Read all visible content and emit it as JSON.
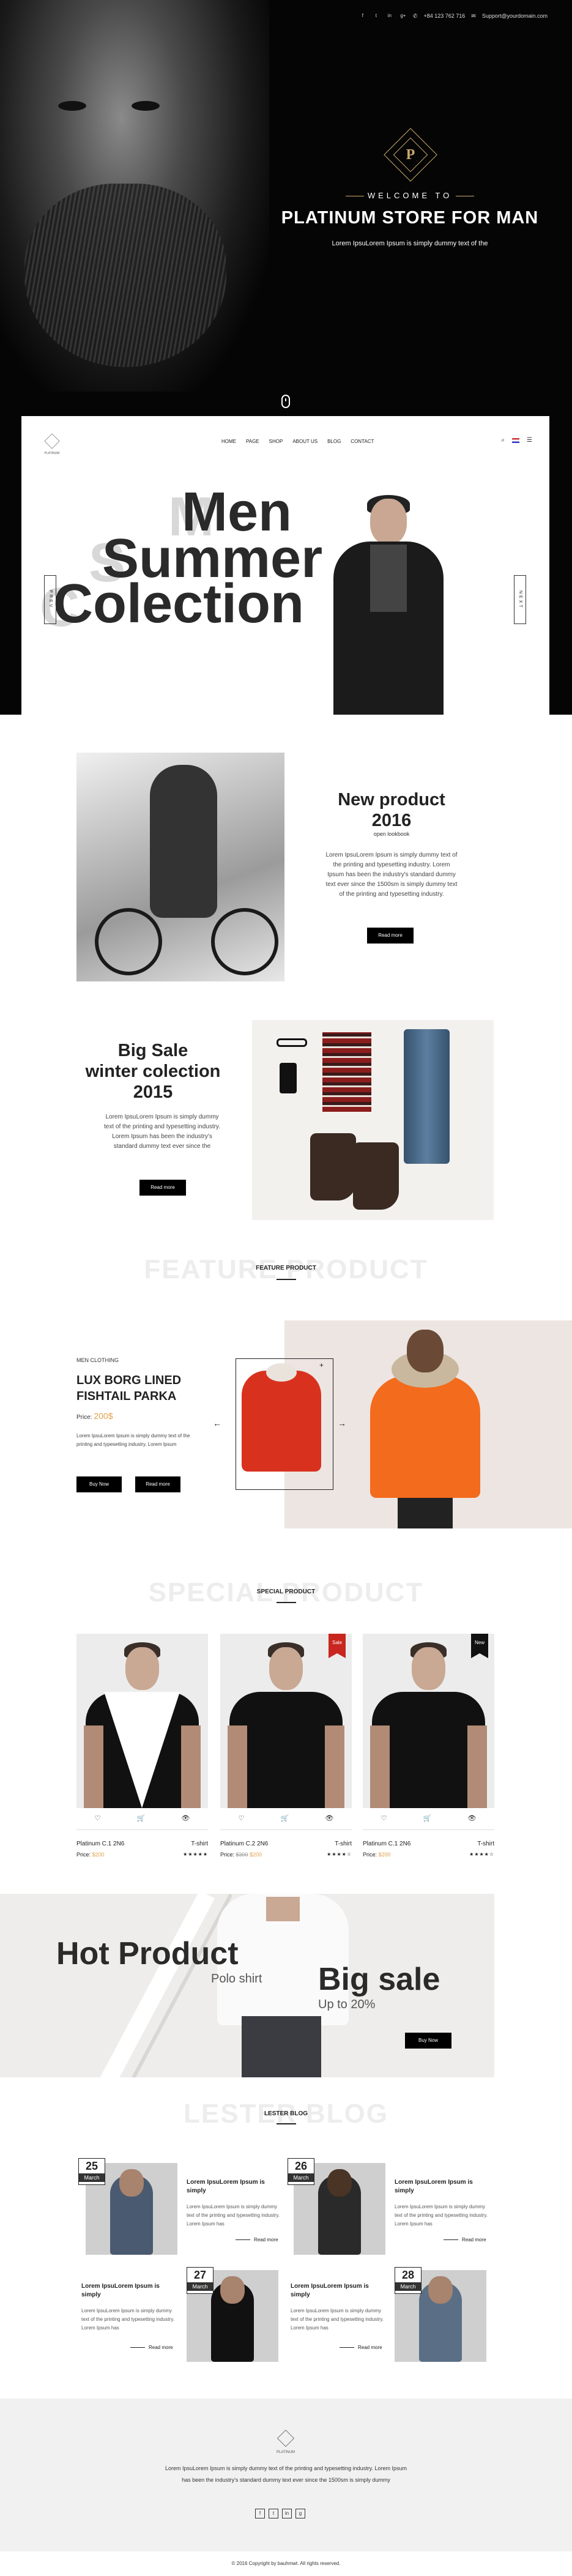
{
  "topbar": {
    "socials": [
      "f",
      "t",
      "in",
      "g+"
    ],
    "phone": "+84 123 762 716",
    "email": "Support@yourdomain.com"
  },
  "hero": {
    "logo_letter": "P",
    "welcome": "WELCOME TO",
    "title": "PLATINUM STORE FOR MAN",
    "subtitle": "Lorem IpsuLorem Ipsum is simply dummy text of the"
  },
  "nav": {
    "logo_text": "PLATINUM",
    "menu": [
      "HOME",
      "PAGE",
      "SHOP",
      "ABOUT US",
      "BLOG",
      "CONTACT"
    ],
    "tools": [
      "⌕",
      "☰"
    ]
  },
  "slider": {
    "line1": "Men",
    "line2": "Summer",
    "line3": "Colection",
    "prev": "PREV",
    "next": "NEXT"
  },
  "new_product": {
    "title_line1": "New product",
    "title_line2": "2016",
    "small": "open lookbook",
    "text": "Lorem IpsuLorem Ipsum is simply dummy text of the printing and typesetting industry. Lorem Ipsum has been the industry's standard dummy text ever since the 1500sm is simply dummy text of the printing and typesetting industry.",
    "button": "Read more"
  },
  "big_sale": {
    "title_line1": "Big Sale",
    "title_line2": "winter colection",
    "title_line3": "2015",
    "text": "Lorem IpsuLorem Ipsum is simply dummy text of the printing and typesetting industry. Lorem Ipsum has been the industry's standard dummy text ever since the",
    "button": "Read more"
  },
  "feature": {
    "ghost": "FEATURE PRODUCT",
    "label": "FEATURE PRODUCT",
    "category": "MEN CLOTHING",
    "name": "LUX BORG LINED FISHTAIL PARKA",
    "price_label": "Price:",
    "price": "200$",
    "desc": "Lorem IpsuLorem Ipsum is simply dummy text of the printing and typesetting industry. Lorem Ipsum",
    "buy": "Buy Now",
    "read": "Read more",
    "prev_arrow": "←",
    "next_arrow": "→",
    "zoom": "+"
  },
  "special": {
    "ghost": "SPECIAL PRODUCT",
    "label": "SPECIAL PRODUCT",
    "icons": [
      "♡",
      "🛒",
      "👁"
    ],
    "products": [
      {
        "name": "Platinum C.1 2N6",
        "type": "T-shirt",
        "price_label": "Price:",
        "price": "$200",
        "old": "",
        "stars": "★★★★★",
        "ribbon": ""
      },
      {
        "name": "Platinum C.2 2N6",
        "type": "T-shirt",
        "price_label": "Price:",
        "price": "$200",
        "old": "$300",
        "stars": "★★★★☆",
        "ribbon": "Sale"
      },
      {
        "name": "Platinum C.1 2N6",
        "type": "T-shirt",
        "price_label": "Price:",
        "price": "$200",
        "old": "",
        "stars": "★★★★☆",
        "ribbon": "New"
      }
    ]
  },
  "hot": {
    "title": "Hot Product",
    "sub": "Polo shirt",
    "big_sale": "Big sale",
    "upto": "Up to 20%",
    "button": "Buy Now"
  },
  "blog": {
    "ghost": "LESTER BLOG",
    "label": "LESTER BLOG",
    "posts": [
      {
        "day": "25",
        "month": "March",
        "title": "Lorem IpsuLorem Ipsum is simply",
        "text": "Lorem IpsuLorem Ipsum is simply dummy text of the printing and typesetting industry. Lorem Ipsum has",
        "more": "Read more"
      },
      {
        "day": "26",
        "month": "March",
        "title": "Lorem IpsuLorem Ipsum is simply",
        "text": "Lorem IpsuLorem Ipsum is simply dummy text of the printing and typesetting industry. Lorem Ipsum has",
        "more": "Read more"
      },
      {
        "day": "27",
        "month": "March",
        "title": "Lorem IpsuLorem Ipsum is simply",
        "text": "Lorem IpsuLorem Ipsum is simply dummy text of the printing and typesetting industry. Lorem Ipsum has",
        "more": "Read more"
      },
      {
        "day": "28",
        "month": "March",
        "title": "Lorem IpsuLorem Ipsum is simply",
        "text": "Lorem IpsuLorem Ipsum is simply dummy text of the printing and typesetting industry. Lorem Ipsum has",
        "more": "Read more"
      }
    ]
  },
  "footer": {
    "logo_text": "PLATINUM",
    "text": "Lorem IpsuLorem Ipsum is simply dummy text of the printing and typesetting industry. Lorem Ipsum has been the industry's standard dummy text ever since the 1500sm is simply dummy",
    "socials": [
      "f",
      "t",
      "in",
      "g"
    ],
    "copyright": "© 2016 Copyright by bauhmwt. All rights reserved."
  },
  "colors": {
    "accent": "#e0a04a",
    "hero_bg": "#050505",
    "sale_ribbon": "#c8261f",
    "new_ribbon": "#111111"
  }
}
